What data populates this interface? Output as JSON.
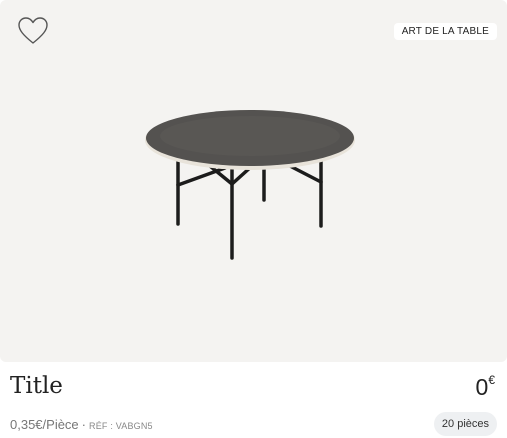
{
  "product": {
    "category_badge": "ART DE LA TABLE",
    "title": "Title",
    "price_value": "0",
    "price_currency": "€",
    "unit_price": "0,35€/Pièce",
    "separator": "·",
    "ref": "RÉF : VABGN5",
    "quantity": "20 pièces"
  },
  "icons": {
    "favorite": "heart-outline-icon"
  },
  "colors": {
    "image_background": "#f4f3f1",
    "table_top": "#545250",
    "table_legs": "#1c1c1c",
    "qty_badge_bg": "#eef0f2"
  }
}
